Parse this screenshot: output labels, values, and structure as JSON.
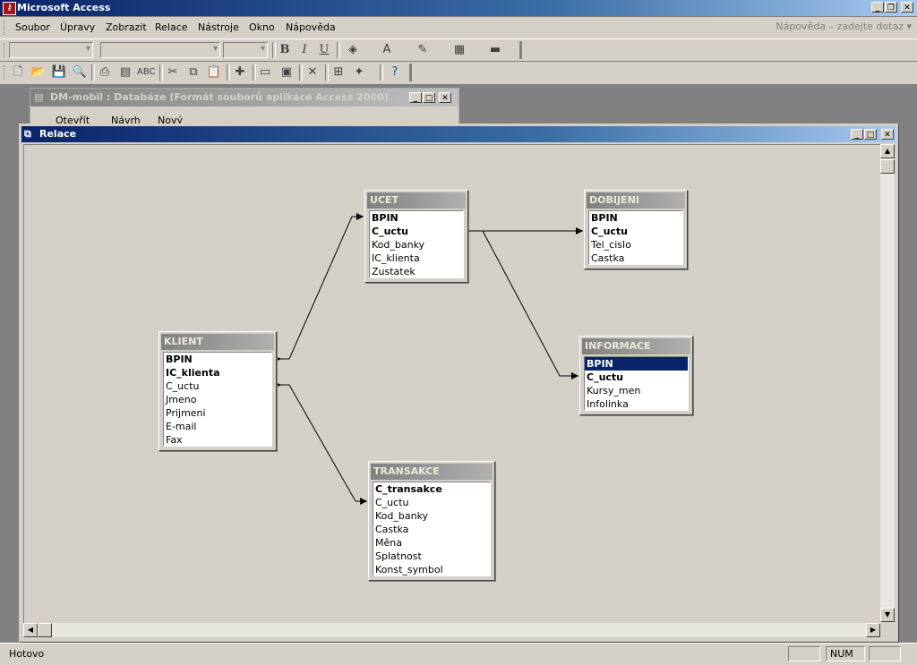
{
  "app": {
    "title": "Microsoft Access"
  },
  "menu": {
    "items": [
      "Soubor",
      "Úpravy",
      "Zobrazit",
      "Relace",
      "Nástroje",
      "Okno",
      "Nápověda"
    ],
    "help_placeholder": "Nápověda – zadejte dotaz"
  },
  "db_window": {
    "title": "DM-mobil : Databáze (Formát souborů aplikace Access 2000)",
    "buttons": [
      "Otevřít",
      "Návrh",
      "Nový"
    ]
  },
  "relations_window": {
    "title": "Relace"
  },
  "tables": [
    {
      "name": "UCET",
      "fields": [
        {
          "n": "BPIN",
          "key": true
        },
        {
          "n": "C_uctu",
          "key": true
        },
        {
          "n": "Kod_banky"
        },
        {
          "n": "IC_klienta"
        },
        {
          "n": "Zustatek"
        }
      ]
    },
    {
      "name": "DOBIJENI",
      "fields": [
        {
          "n": "BPIN",
          "key": true
        },
        {
          "n": "C_uctu",
          "key": true
        },
        {
          "n": "Tel_cislo"
        },
        {
          "n": "Castka"
        }
      ]
    },
    {
      "name": "KLIENT",
      "fields": [
        {
          "n": "BPIN",
          "key": true
        },
        {
          "n": "IC_klienta",
          "key": true
        },
        {
          "n": "C_uctu"
        },
        {
          "n": "Jmeno"
        },
        {
          "n": "Prijmeni"
        },
        {
          "n": "E-mail"
        },
        {
          "n": "Fax"
        }
      ]
    },
    {
      "name": "INFORMACE",
      "fields": [
        {
          "n": "BPIN",
          "key": true,
          "selected": true
        },
        {
          "n": "C_uctu",
          "key": true
        },
        {
          "n": "Kursy_men"
        },
        {
          "n": "Infolinka"
        }
      ]
    },
    {
      "name": "TRANSAKCE",
      "fields": [
        {
          "n": "C_transakce",
          "key": true
        },
        {
          "n": "C_uctu"
        },
        {
          "n": "Kod_banky"
        },
        {
          "n": "Castka"
        },
        {
          "n": "Měna"
        },
        {
          "n": "Splatnost"
        },
        {
          "n": "Konst_symbol"
        }
      ]
    }
  ],
  "status": {
    "text": "Hotovo",
    "num": "NUM"
  }
}
